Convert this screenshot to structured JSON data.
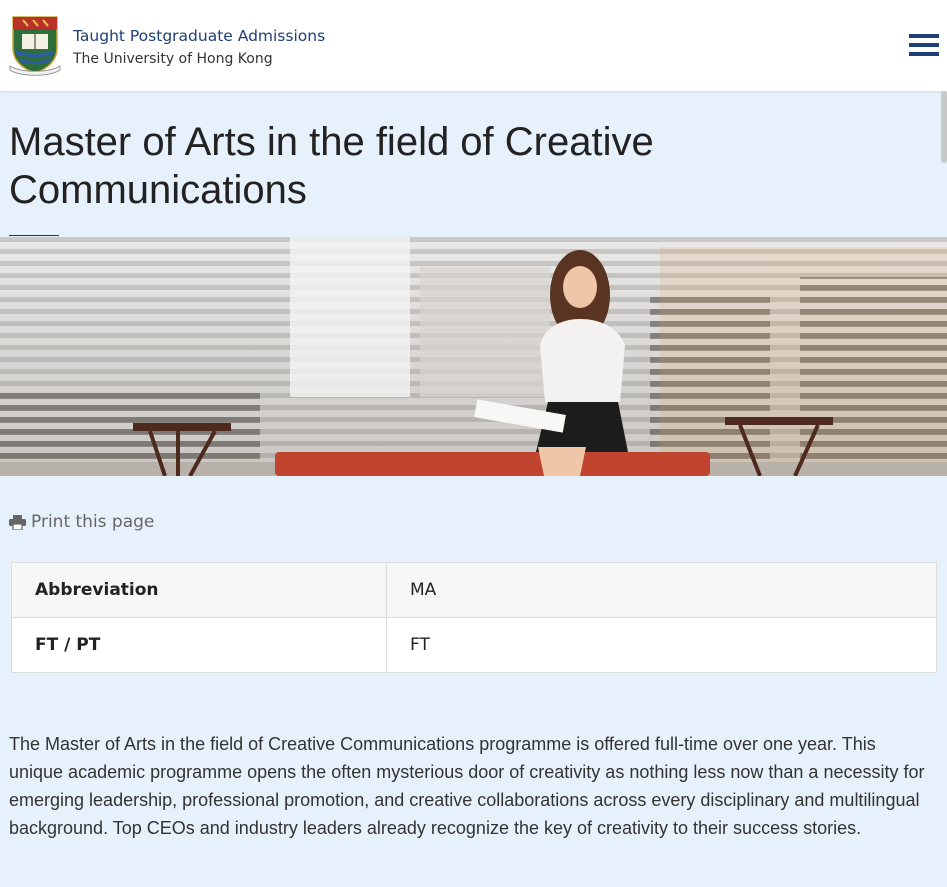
{
  "header": {
    "site_title": "Taught Postgraduate Admissions",
    "university_name": "The University of Hong Kong",
    "crest_motto": "SAPIENTIA ET VIRTUS",
    "brand_color": "#1f3f78",
    "menu_icon": "hamburger-menu-icon"
  },
  "page": {
    "title": "Master of Arts in the field of Creative Communications"
  },
  "print": {
    "icon": "printer-icon",
    "label": "Print this page"
  },
  "programme_table": {
    "rows": [
      {
        "label": "Abbreviation",
        "value": "MA"
      },
      {
        "label": "FT / PT",
        "value": "FT"
      }
    ]
  },
  "description": "The Master of Arts in the field of Creative Communications programme is offered full-time over one year. This unique academic programme opens the often mysterious door of creativity as nothing less now than a necessity for emerging leadership, professional promotion, and creative collaborations across every disciplinary and multilingual background. Top CEOs and industry leaders already recognize the key of creativity to their success stories."
}
